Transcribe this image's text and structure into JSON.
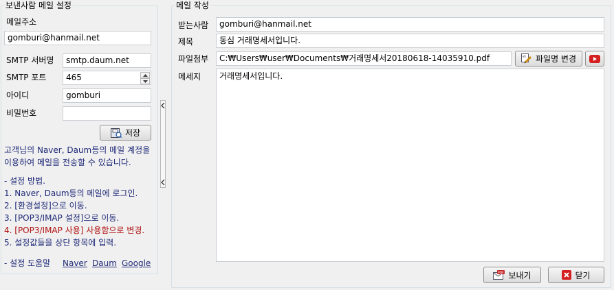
{
  "sender": {
    "legend": "보낸사람 메일 설정",
    "email_label": "메일주소",
    "email_value": "gomburi@hanmail.net",
    "smtp_server_label": "SMTP 서버명",
    "smtp_server_value": "smtp.daum.net",
    "smtp_port_label": "SMTP 포트",
    "smtp_port_value": "465",
    "id_label": "아이디",
    "id_value": "gomburi",
    "password_label": "비밀번호",
    "password_value": "",
    "save_label": "저장",
    "info_line1": "고객님의 Naver, Daum등의 메일 계정을",
    "info_line2": "이용하여 메일을 전송할 수 있습니다.",
    "steps_title": "- 설정 방법.",
    "step1": "1. Naver, Daum등의 메일에 로그인.",
    "step2": "2. [환경설정]으로 이동.",
    "step3": "3. [POP3/IMAP 설정]으로 이동.",
    "step4": "4. [POP3/IMAP 사용] 사용함으로 변경.",
    "step5": "5. 설정값들을 상단 항목에 입력.",
    "help_label": "- 설정 도움말",
    "help_links": [
      "Naver",
      "Daum",
      "Google"
    ]
  },
  "compose": {
    "legend": "메일 작성",
    "to_label": "받는사람",
    "to_value": "gomburi@hanmail.net",
    "subject_label": "제목",
    "subject_value": "동심 거래명세서입니다.",
    "attach_label": "파일첨부",
    "attach_value": "C:₩Users₩user₩Documents₩거래명세서20180618-14035910.pdf",
    "rename_label": "파일명 변경",
    "message_label": "메세지",
    "message_value": "거래명세서입니다.",
    "send_label": "보내기",
    "close_label": "닫기"
  },
  "icons": {
    "save": "save-icon",
    "rename": "edit-file-icon",
    "play": "play-icon",
    "send": "send-mail-icon",
    "close": "close-icon",
    "collapse": "chevron-left-icon"
  },
  "colors": {
    "navy_text": "#1f2a78",
    "warning_text": "#b01010",
    "group_border": "#d5dfe5"
  }
}
